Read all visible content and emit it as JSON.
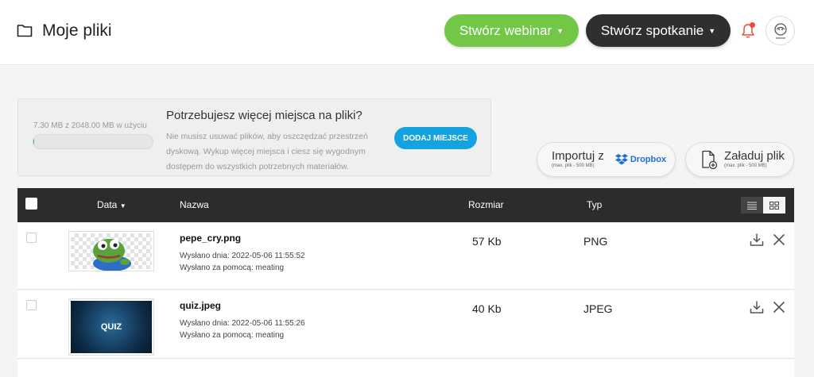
{
  "header": {
    "title": "Moje pliki",
    "webinar_button": "Stwórz webinar",
    "meeting_button": "Stwórz spotkanie",
    "notification_dot_color": "#e74c3c"
  },
  "storage": {
    "usage_text": "7.30 MB z 2048.00 MB w użyciu",
    "usage_fraction": 0.0036,
    "title": "Potrzebujesz więcej miejsca na pliki?",
    "description": "Nie musisz usuwać plików, aby oszczędzać przestrzeń dyskową. Wykup więcej miejsca i ciesz się wygodnym dostępem do wszystkich potrzebnych materiałów.",
    "add_space_button": "DODAJ MIEJSCE"
  },
  "actions": {
    "import_label": "Importuj z",
    "import_limit": "(max. plik - 500 MB)",
    "dropbox_label": "Dropbox",
    "upload_label": "Załaduj plik",
    "upload_limit": "(max. plik - 500 MB)"
  },
  "table": {
    "columns": {
      "date": "Data",
      "name": "Nazwa",
      "size": "Rozmiar",
      "type": "Typ"
    },
    "rows": [
      {
        "name": "pepe_cry.png",
        "sent": "Wysłano dnia: 2022-05-06 11:55:52",
        "via": "Wysłano za pomocą: meating",
        "size": "57 Kb",
        "type": "PNG"
      },
      {
        "name": "quiz.jpeg",
        "sent": "Wysłano dnia: 2022-05-06 11:55:26",
        "via": "Wysłano za pomocą: meating",
        "size": "40 Kb",
        "type": "JPEG",
        "thumb_text": "QUIZ"
      }
    ]
  },
  "colors": {
    "webinar_green": "#72c747",
    "meeting_dark": "#2d2f31",
    "accent_blue": "#12a3e0",
    "table_header": "#2c2c2c"
  }
}
